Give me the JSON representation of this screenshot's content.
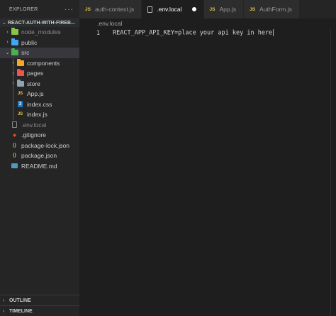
{
  "sidebar": {
    "title": "EXPLORER",
    "more": "···",
    "root": "REACT-AUTH-WITH-FIREB...",
    "items": [
      {
        "label": "node_modules",
        "type": "folder",
        "expanded": false,
        "icon": "node-modules-folder-icon",
        "color": "#8bc34a"
      },
      {
        "label": "public",
        "type": "folder",
        "expanded": false,
        "icon": "public-folder-icon",
        "color": "#42a5f5"
      },
      {
        "label": "src",
        "type": "folder",
        "expanded": true,
        "selected": true,
        "icon": "src-folder-icon",
        "color": "#4caf50"
      },
      {
        "label": "components",
        "type": "folder",
        "expanded": false,
        "icon": "components-folder-icon",
        "color": "#f9a825"
      },
      {
        "label": "pages",
        "type": "folder",
        "expanded": false,
        "icon": "pages-folder-icon",
        "color": "#ef5350"
      },
      {
        "label": "store",
        "type": "folder",
        "expanded": false,
        "icon": "store-folder-icon",
        "color": "#90a4ae"
      },
      {
        "label": "App.js",
        "type": "js",
        "icon": "js-file-icon"
      },
      {
        "label": "index.css",
        "type": "css",
        "icon": "css-file-icon"
      },
      {
        "label": "index.js",
        "type": "js",
        "icon": "js-file-icon"
      },
      {
        "label": ".env.local",
        "type": "file",
        "icon": "file-icon"
      },
      {
        "label": ".gitignore",
        "type": "git",
        "icon": "git-icon"
      },
      {
        "label": "package-lock.json",
        "type": "json",
        "icon": "json-file-icon"
      },
      {
        "label": "package.json",
        "type": "json",
        "icon": "json-file-icon"
      },
      {
        "label": "README.md",
        "type": "md",
        "icon": "readme-icon"
      }
    ],
    "outline": "OUTLINE",
    "timeline": "TIMELINE"
  },
  "tabs": [
    {
      "label": "auth-context.js",
      "icon": "js-file-icon",
      "badge": "JS",
      "active": false
    },
    {
      "label": ".env.local",
      "icon": "file-icon",
      "active": true,
      "dirty": true
    },
    {
      "label": "App.js",
      "icon": "js-file-icon",
      "badge": "JS",
      "active": false
    },
    {
      "label": "AuthForm.js",
      "icon": "js-file-icon",
      "badge": "JS",
      "active": false
    }
  ],
  "editor": {
    "breadcrumb": ".env.local",
    "lines": [
      {
        "number": "1",
        "text": "REACT_APP_API_KEY=place your api key in here"
      }
    ]
  },
  "colors": {
    "editor_bg": "#1e1e1e",
    "sidebar_bg": "#252526",
    "selected_row": "#37373d",
    "js_badge": "#e8c94a"
  }
}
